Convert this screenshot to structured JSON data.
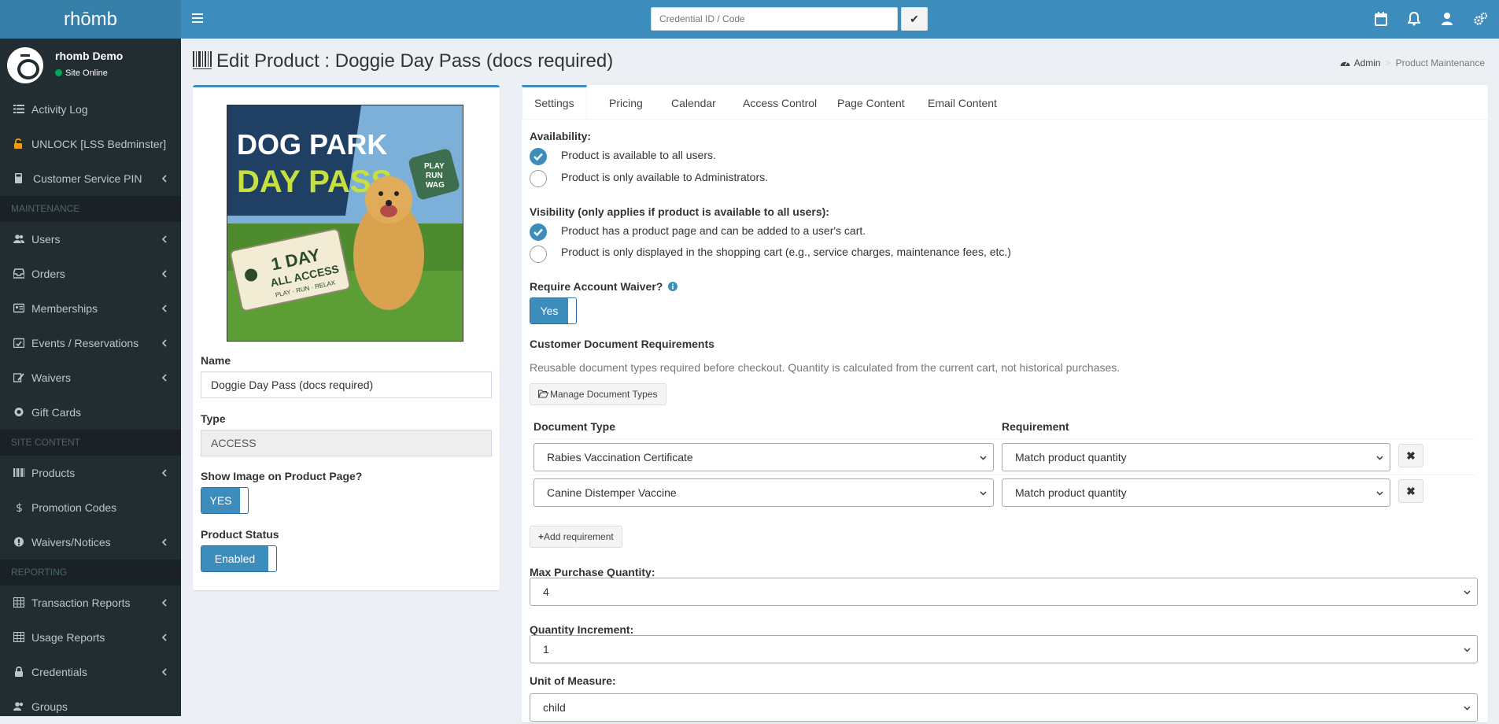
{
  "app": {
    "logo_text": "rhōmb"
  },
  "topbar": {
    "credential_placeholder": "Credential ID / Code",
    "submit_label": "✔"
  },
  "user": {
    "name": "rhomb Demo",
    "status": "Site Online"
  },
  "sidebar": {
    "items_top": [
      {
        "label": "Activity Log"
      },
      {
        "label": "UNLOCK [LSS Bedminster]"
      },
      {
        "label": "Customer Service PIN"
      }
    ],
    "header_maintenance": "MAINTENANCE",
    "items_maintenance": [
      {
        "label": "Users"
      },
      {
        "label": "Orders"
      },
      {
        "label": "Memberships"
      },
      {
        "label": "Events / Reservations"
      },
      {
        "label": "Waivers"
      },
      {
        "label": "Gift Cards"
      }
    ],
    "header_site": "SITE CONTENT",
    "items_site": [
      {
        "label": "Products"
      },
      {
        "label": "Promotion Codes"
      },
      {
        "label": "Waivers/Notices"
      }
    ],
    "header_reporting": "REPORTING",
    "items_reporting": [
      {
        "label": "Transaction Reports"
      },
      {
        "label": "Usage Reports"
      },
      {
        "label": "Credentials"
      },
      {
        "label": "Groups"
      }
    ]
  },
  "page": {
    "title": "Edit Product : Doggie Day Pass (docs required)",
    "breadcrumb_home": "Admin",
    "breadcrumb_current": "Product Maintenance"
  },
  "product": {
    "image": {
      "line1": "DOG PARK",
      "line2": "DAY PASS",
      "ticket1": "1 DAY",
      "ticket2": "ALL ACCESS",
      "ticket3": "PLAY · RUN · RELAX",
      "sign1": "PLAY",
      "sign2": "RUN",
      "sign3": "WAG"
    },
    "name_label": "Name",
    "name_value": "Doggie Day Pass (docs required)",
    "type_label": "Type",
    "type_value": "ACCESS",
    "show_image_label": "Show Image on Product Page?",
    "show_image_value": "YES",
    "status_label": "Product Status",
    "status_value": "Enabled"
  },
  "tabs": [
    {
      "label": "Settings"
    },
    {
      "label": "Pricing"
    },
    {
      "label": "Calendar"
    },
    {
      "label": "Access Control"
    },
    {
      "label": "Page Content"
    },
    {
      "label": "Email Content"
    }
  ],
  "settings": {
    "availability_label": "Availability:",
    "availability_opt1": "Product is available to all users.",
    "availability_opt2": "Product is only available to Administrators.",
    "visibility_label": "Visibility (only applies if product is available to all users):",
    "visibility_opt1": "Product has a product page and can be added to a user's cart.",
    "visibility_opt2": "Product is only displayed in the shopping cart (e.g., service charges, maintenance fees, etc.)",
    "waiver_label": "Require Account Waiver?",
    "waiver_value": "Yes",
    "docs_label": "Customer Document Requirements",
    "docs_help": "Reusable document types required before checkout. Quantity is calculated from the current cart, not historical purchases.",
    "manage_docs_button": "Manage Document Types",
    "col_doc_type": "Document Type",
    "col_requirement": "Requirement",
    "doc_rows": [
      {
        "type": "Rabies Vaccination Certificate",
        "requirement": "Match product quantity"
      },
      {
        "type": "Canine Distemper Vaccine",
        "requirement": "Match product quantity"
      }
    ],
    "add_requirement_button": "Add requirement",
    "max_qty_label": "Max Purchase Quantity:",
    "max_qty_value": "4",
    "qty_inc_label": "Quantity Increment:",
    "qty_inc_value": "1",
    "uom_label": "Unit of Measure:",
    "uom_value": "child"
  },
  "colors": {
    "primary": "#3c8dbc",
    "sidebar_bg": "#222d32",
    "logo_bg": "#367fa9"
  }
}
